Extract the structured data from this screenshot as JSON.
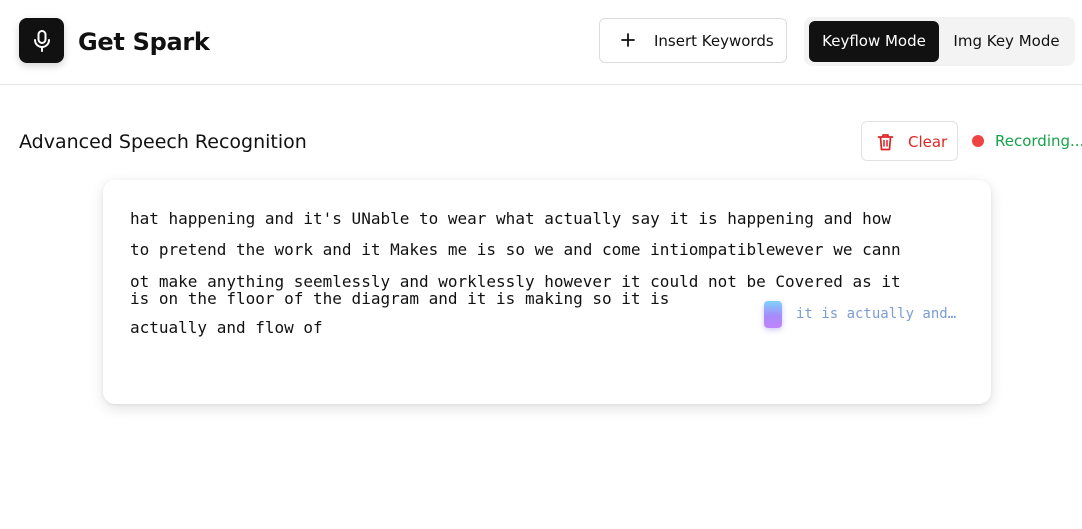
{
  "app": {
    "title": "Get Spark",
    "logo_icon": "microphone-icon"
  },
  "toolbar": {
    "insert_keywords_label": "Insert Keywords",
    "insert_icon": "plus-icon",
    "modes": [
      "Keyflow Mode",
      "Img Key Mode"
    ],
    "active_mode": "Keyflow Mode"
  },
  "section": {
    "title": "Advanced Speech Recognition",
    "clear_label": "Clear",
    "clear_icon": "trash-icon",
    "status_text": "Recording..."
  },
  "transcript": {
    "lines": [
      "hat happening and it's UNable to wear what actually say it is happening and how",
      "to pretend the work and it Makes me is so we and come intiompatiblewever we cann",
      "ot make anything seemlessly and worklessly however it could not be Covered as it",
      "is on the floor of the diagram and it is making so it is",
      "actually and flow of"
    ],
    "suggestion": "it is actually and…"
  },
  "colors": {
    "primary": "#111111",
    "danger": "#dc2626",
    "recording_dot": "#ef4444",
    "recording_text": "#16a34a",
    "suggestion_text": "#7b9cd6"
  }
}
